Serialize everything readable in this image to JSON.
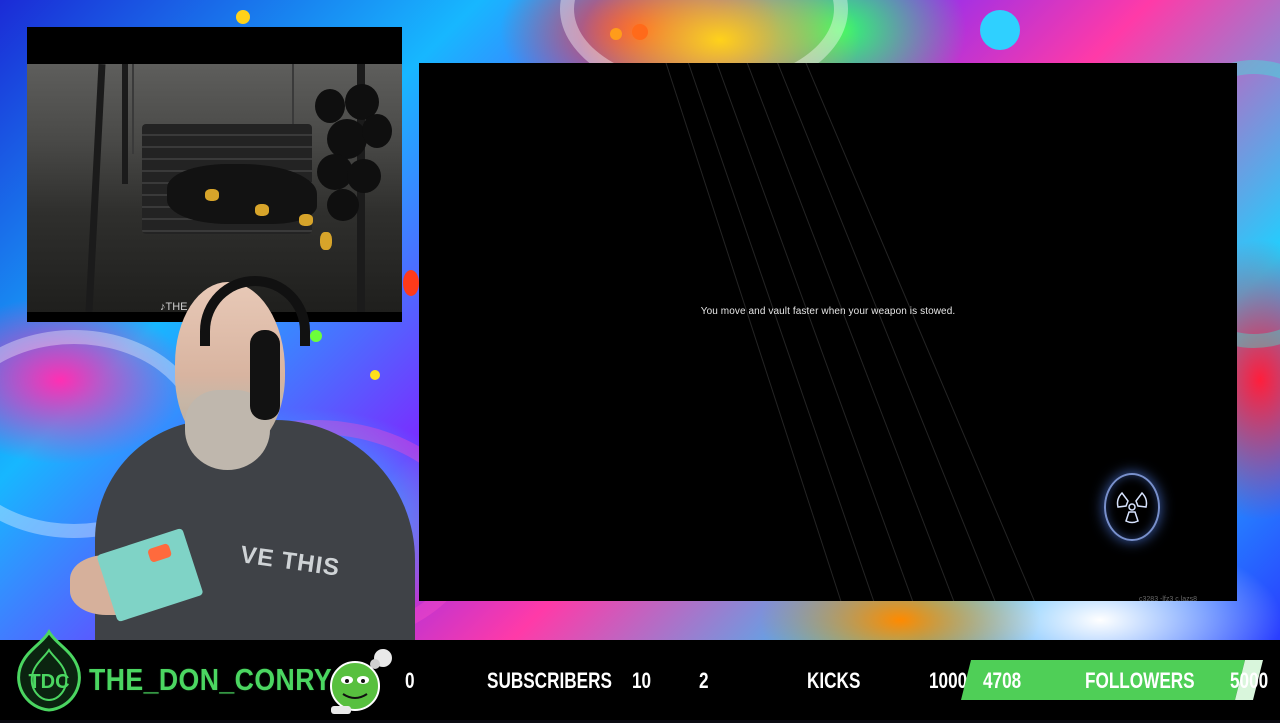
{
  "video": {
    "caption": "♪THE"
  },
  "webcam": {
    "shirt_text": "VE THIS"
  },
  "game": {
    "tip": "You move and vault faster when your weapon is stowed.",
    "build_id": "c3283 -lfz3 c.lazs8"
  },
  "bottom_bar": {
    "logo_text": "TDC",
    "channel_name": "THE_DON_CONRY",
    "subscribers": {
      "current": "0",
      "label": "SUBSCRIBERS",
      "goal": "10"
    },
    "kicks": {
      "current": "2",
      "label": "KICKS",
      "goal": "10000"
    },
    "followers": {
      "current": "4708",
      "label": "FOLLOWERS",
      "goal": "5000",
      "progress_fraction": 0.94
    }
  },
  "colors": {
    "brand_green": "#4bd661",
    "progress_green": "#4fcf57",
    "background_black": "#000000"
  },
  "icons": {
    "logo": "tdc-flame-logo",
    "mascot": "green-smiley-mascot",
    "game_button": "radiation-icon"
  }
}
